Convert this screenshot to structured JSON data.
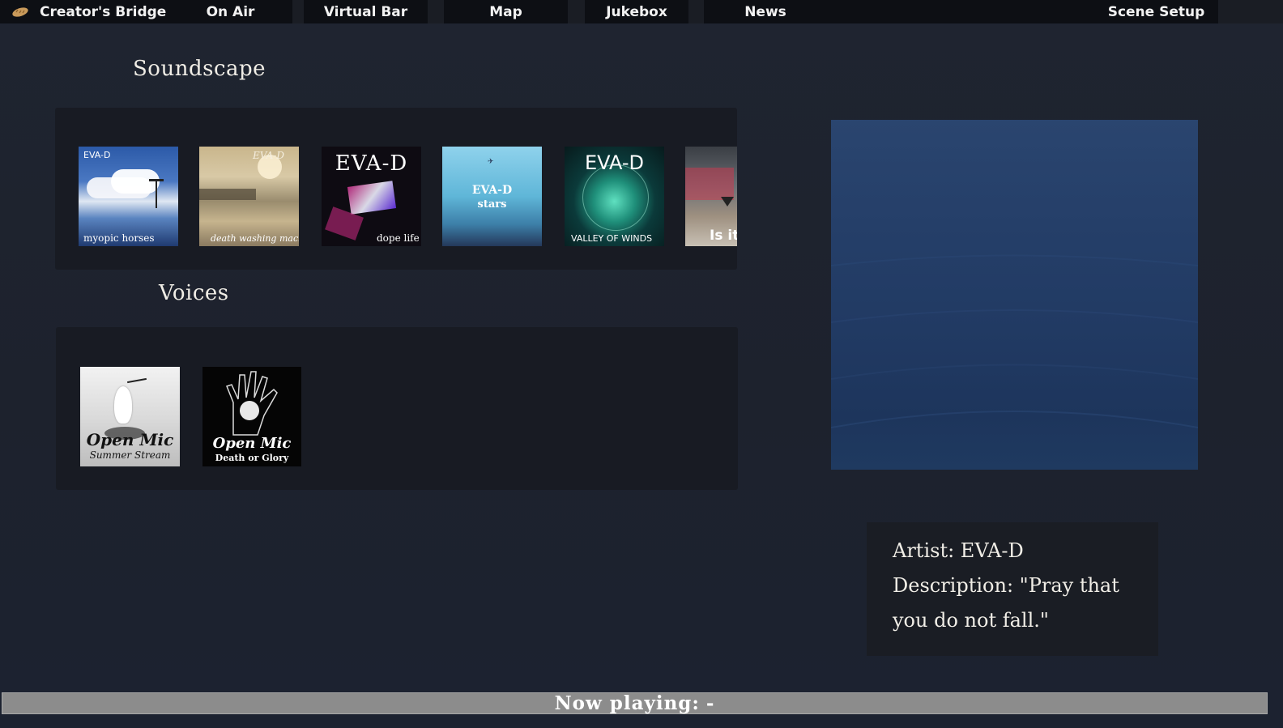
{
  "nav": {
    "brand_label": "Creator's Bridge",
    "brand_icon": "bread-icon",
    "tabs": [
      "On Air",
      "Virtual Bar",
      "Map",
      "Jukebox",
      "News"
    ],
    "scene_setup_label": "Scene Setup"
  },
  "soundscape": {
    "title": "Soundscape",
    "albums": [
      {
        "artist": "EVA-D",
        "caption": "myopic horses"
      },
      {
        "artist": "EVA-D",
        "caption": "death washing machine"
      },
      {
        "artist": "EVA-D",
        "caption": "dope life"
      },
      {
        "artist": "EVA-D",
        "caption": "stars"
      },
      {
        "artist": "EVA-D",
        "caption": "VALLEY OF WINDS"
      },
      {
        "artist": "",
        "caption": "Is it"
      }
    ]
  },
  "voices": {
    "title": "Voices",
    "albums": [
      {
        "title": "Open Mic",
        "subtitle": "Summer Stream"
      },
      {
        "title": "Open Mic",
        "subtitle": "Death or Glory"
      }
    ]
  },
  "info": {
    "artist_line": "Artist: EVA-D",
    "description_line": "Description: \"Pray that you do not fall.\""
  },
  "now_playing": {
    "label": "Now playing:",
    "value": "-"
  },
  "colors": {
    "background": "#1f2430",
    "panel": "#181b23",
    "nav_tab": "#0d0f14",
    "preview_blue": "#253f69",
    "now_playing_bar": "#8c8c8c"
  }
}
